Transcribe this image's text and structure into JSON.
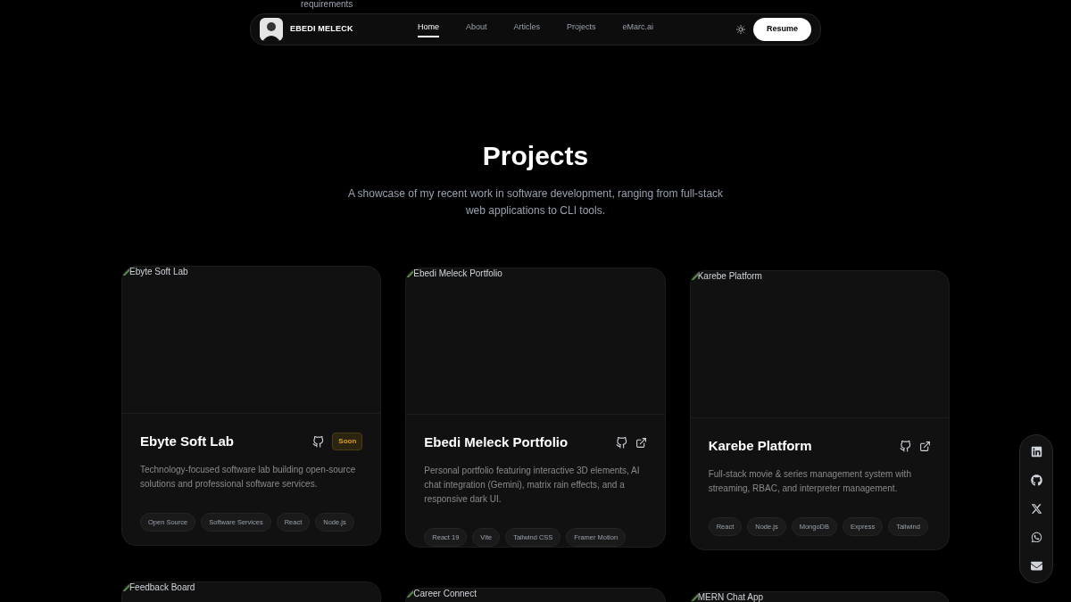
{
  "top_cut_text": "requirements",
  "navbar": {
    "brand": "EBEDI MELECK",
    "links": [
      {
        "label": "Home",
        "selected": true
      },
      {
        "label": "About",
        "selected": false
      },
      {
        "label": "Articles",
        "selected": false
      },
      {
        "label": "Projects",
        "selected": false
      },
      {
        "label": "eMarc.ai",
        "selected": false
      }
    ],
    "button": "Resume"
  },
  "header": {
    "title": "Projects",
    "subtitle": "A showcase of my recent work in software development, ranging from full-stack web applications to CLI tools."
  },
  "projects": [
    {
      "image_alt": "Ebyte Soft Lab",
      "title": "Ebyte Soft Lab",
      "links": [
        {
          "kind": "github"
        }
      ],
      "badge": "Soon",
      "description": "Technology-focused software lab building open-source solutions and professional software services.",
      "tags": [
        "Open Source",
        "Software Services",
        "React",
        "Node.js"
      ]
    },
    {
      "image_alt": "Ebedi Meleck Portfolio",
      "title": "Ebedi Meleck Portfolio",
      "links": [
        {
          "kind": "github"
        },
        {
          "kind": "external"
        }
      ],
      "description": "Personal portfolio featuring interactive 3D elements, AI chat integration (Gemini), matrix rain effects, and a responsive dark UI.",
      "tags": [
        "React 19",
        "Vite",
        "Tailwind CSS",
        "Framer Motion"
      ]
    },
    {
      "image_alt": "Karebe Platform",
      "title": "Karebe Platform",
      "links": [
        {
          "kind": "github"
        },
        {
          "kind": "external"
        }
      ],
      "description": "Full-stack movie & series management system with streaming, RBAC, and interpreter management.",
      "tags": [
        "React",
        "Node.js",
        "MongoDB",
        "Express",
        "Tailwind"
      ]
    },
    {
      "image_alt": "Feedback Board"
    },
    {
      "image_alt": "Career Connect"
    },
    {
      "image_alt": "MERN Chat App"
    }
  ],
  "social": [
    {
      "kind": "linkedin"
    },
    {
      "kind": "github"
    },
    {
      "kind": "x"
    },
    {
      "kind": "whatsapp"
    },
    {
      "kind": "email"
    }
  ]
}
